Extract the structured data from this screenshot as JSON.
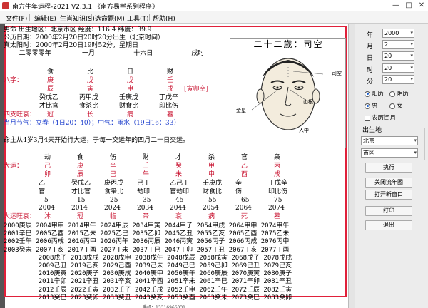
{
  "window": {
    "title": "南方牛年运程-2021  V2.3.1  《南方易学系列程序》",
    "controls": {
      "minimize": "—",
      "maximize": "□",
      "close": "✕"
    }
  },
  "menu": [
    "文件(F)",
    "编辑(E)",
    "生肖知识(S)",
    "选命题(M)",
    "工具(T)",
    "帮助(H)"
  ],
  "info": {
    "line1": "男命    出生地区：北京市区   经度：116.4 纬度：39.9",
    "line2": "公历日期：2000年2月20日20时20分出生（北京时间）",
    "line3": "真太阳时：2000年2月20日19时52分，星期日",
    "line4": "    二零零零年        一月          十六日          戌时"
  },
  "portrait": {
    "title": "二十二歲：司空",
    "labels": [
      "金星",
      "山根",
      "司空",
      "人中"
    ]
  },
  "pillars": {
    "gods": [
      "食",
      "比",
      "日",
      "财"
    ],
    "stems": [
      "庚",
      "戊",
      "戊",
      "壬"
    ],
    "branches": [
      "辰",
      "寅",
      "申",
      "戌"
    ],
    "kong": "[寅卯空]",
    "hidden": [
      "癸戊乙",
      "丙甲戊",
      "壬庚戊",
      "丁戊辛"
    ],
    "hidden_gods": [
      "才比官",
      "食杀比",
      "财食比",
      "印比伤"
    ]
  },
  "labels": {
    "bazi": "八字：",
    "strength": "四支旺衰：",
    "dayun": "大运：",
    "yunwang": "大运旺衰："
  },
  "strength_values": [
    "冠",
    "长",
    "病",
    "墓"
  ],
  "jieqi": "当月节气：立春（4日20：40）；中气：雨水（19日16：33）",
  "dayun_intro": "命主从4岁3月4天开始行大运，于每一交运年的四月二十日交运。",
  "dayun": {
    "gods": [
      "劫",
      "食",
      "伤",
      "财",
      "才",
      "杀",
      "官",
      "枭"
    ],
    "stems": [
      "己",
      "庚",
      "辛",
      "壬",
      "癸",
      "甲",
      "乙",
      "丙"
    ],
    "branches": [
      "卯",
      "辰",
      "巳",
      "午",
      "未",
      "申",
      "酉",
      "戌"
    ],
    "hidden": [
      "乙",
      "癸戊乙",
      "庚丙戊",
      "己丁",
      "乙己丁",
      "壬庚戊",
      "辛",
      "丁戊辛"
    ],
    "hidden_gods": [
      "官",
      "才比官",
      "食枭比",
      "劫印",
      "官劫印",
      "财食比",
      "伤",
      "印比伤"
    ],
    "ages": [
      "5",
      "15",
      "25",
      "35",
      "45",
      "55",
      "65",
      "75"
    ],
    "years": [
      "2004",
      "2014",
      "2024",
      "2034",
      "2044",
      "2054",
      "2064",
      "2074"
    ],
    "strength": [
      "沐",
      "冠",
      "临",
      "帝",
      "衰",
      "病",
      "死",
      "墓"
    ]
  },
  "liunian_rows": [
    "2000庚辰 2004甲申 2014甲午 2024甲辰 2034甲寅 2044甲子 2054甲戌 2064甲申 2074甲午",
    "2001辛巳 2005乙酉 2015乙未 2025乙巳 2035乙卯 2045乙丑 2055乙亥 2065乙酉 2075乙未",
    "2002壬午 2006丙戌 2016丙申 2026丙午 2036丙辰 2046丙寅 2056丙子 2066丙戌 2076丙申",
    "2003癸未 2007丁亥 2017丁酉 2027丁未 2037丁巳 2047丁卯 2057丁丑 2067丁亥 2077丁酉",
    "         2008戊子 2018戊戌 2028戊申 2038戊午 2048戊辰 2058戊寅 2068戊子 2078戊戌",
    "         2009己丑 2019己亥 2029己酉 2039己未 2049己巳 2059己卯 2069己丑 2079己亥",
    "         2010庚寅 2020庚子 2030庚戌 2040庚申 2050庚午 2060庚辰 2070庚寅 2080庚子",
    "         2011辛卯 2021辛丑 2031辛亥 2041辛酉 2051辛未 2061辛巳 2071辛卯 2081辛丑",
    "         2012壬辰 2022壬寅 2032壬子 2042壬戌 2052壬申 2062壬午 2072壬辰 2082壬寅",
    "         2013癸巳 2023癸卯 2033癸丑 2043癸亥 2053癸酉 2063癸未 2073癸巳 2083癸卯"
  ],
  "form": {
    "year_label": "年",
    "year": "2000",
    "month_label": "月",
    "month": "2",
    "day_label": "日",
    "day": "20",
    "hour_label": "时",
    "hour": "20",
    "minute_label": "分",
    "minute": "20",
    "cal_solar": "阳历",
    "cal_lunar": "阴历",
    "sex_male": "男",
    "sex_female": "女",
    "leap": "农历闰月",
    "birthplace_label": "出生地",
    "province": "北京",
    "district": "市区"
  },
  "buttons": {
    "run": "执行",
    "close_liunian": "关闭流年图",
    "open_window": "打开新窗口",
    "print": "打印",
    "exit": "退出"
  },
  "status": "手机：13316966031"
}
